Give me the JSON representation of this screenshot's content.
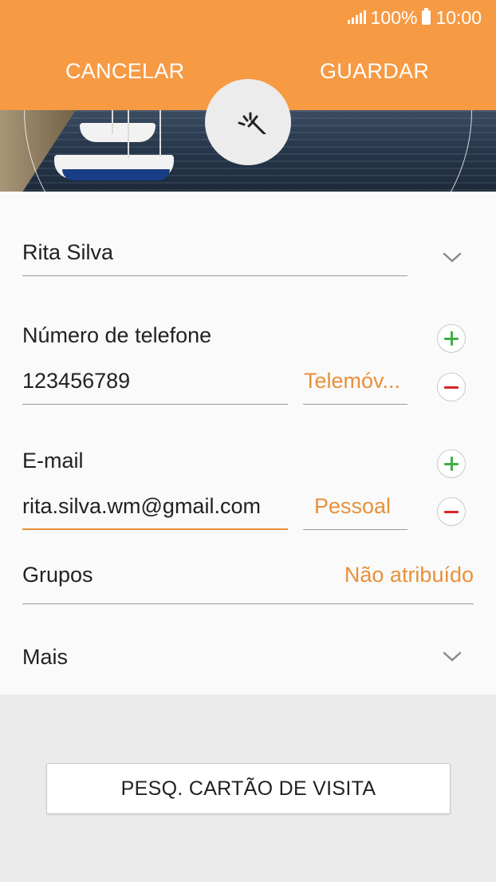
{
  "status_bar": {
    "battery": "100%",
    "time": "10:00"
  },
  "header": {
    "cancel_label": "CANCELAR",
    "save_label": "GUARDAR"
  },
  "contact": {
    "name": "Rita Silva",
    "phone": {
      "section_label": "Número de telefone",
      "value": "123456789",
      "type": "Telemóv..."
    },
    "email": {
      "section_label": "E-mail",
      "value": "rita.silva.wm@gmail.com",
      "type": "Pessoal"
    },
    "groups": {
      "label": "Grupos",
      "value": "Não atribuído"
    },
    "more_label": "Mais"
  },
  "footer": {
    "scan_card_label": "PESQ. CARTÃO DE VISITA"
  },
  "colors": {
    "accent": "#f79a44",
    "accent_text": "#e8903a",
    "add": "#3fae49",
    "remove": "#d32525"
  },
  "icons": [
    "signal-icon",
    "battery-icon",
    "camera-icon",
    "chevron-down-icon",
    "plus-icon",
    "minus-icon"
  ]
}
